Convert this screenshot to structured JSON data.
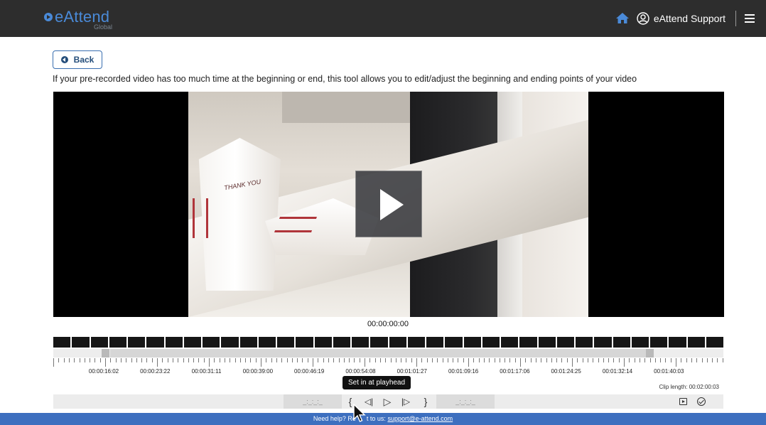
{
  "header": {
    "logo_text": "eAttend",
    "logo_sub": "Global",
    "support_label": "eAttend Support",
    "icons": [
      "home-icon",
      "user-circle-icon",
      "menu-icon"
    ],
    "background_color": "#2d2d2d",
    "accent_color": "#4a8ad8"
  },
  "page": {
    "back_label": "Back",
    "intro_text": "If your pre-recorded video has too much time at the beginning or end, this tool allows you to edit/adjust the beginning and ending points of your video"
  },
  "player": {
    "current_time": "00:00:00:00",
    "video_caption": "THANK YOU"
  },
  "timeline": {
    "tick_labels": [
      "00:00:16:02",
      "00:00:23:22",
      "00:00:31:11",
      "00:00:39:00",
      "00:00:46:19",
      "00:00:54:08",
      "00:01:01:27",
      "00:01:09:16",
      "00:01:17:06",
      "00:01:24:25",
      "00:01:32:14",
      "00:01:40:03"
    ],
    "clip_length": "Clip length: 00:02:00:03",
    "tooltip": "Set in at playhead",
    "in_timecode": "_:_:_:_",
    "out_timecode": "_:_:_:_"
  },
  "controls": {
    "set_in": "{",
    "prev_frame": "◁|",
    "play": "▷",
    "next_frame": "|▷",
    "set_out": "}"
  },
  "footer": {
    "text": "Need help? Re",
    "text2": "t to us: ",
    "link": "support@e-attend.com",
    "background_color": "#3d6fbf"
  }
}
